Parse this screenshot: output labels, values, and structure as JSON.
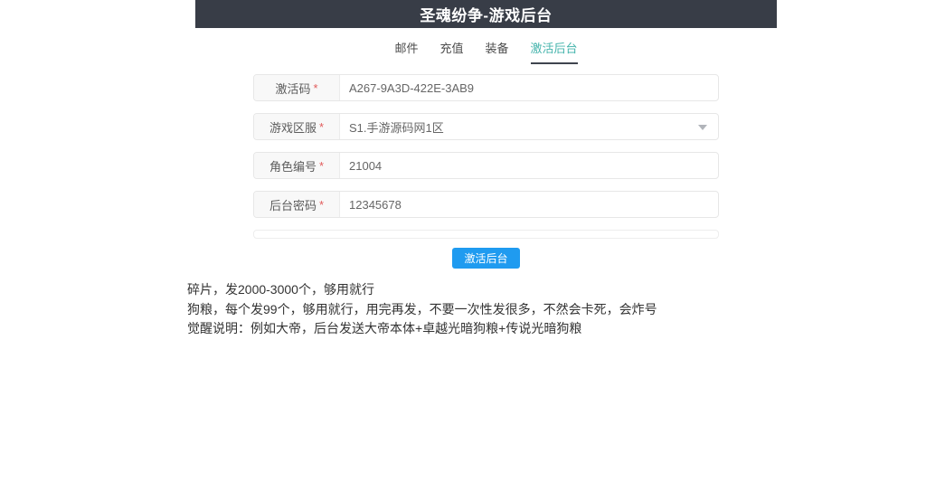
{
  "header": {
    "title": "圣魂纷争-游戏后台"
  },
  "tabs": [
    {
      "label": "邮件",
      "active": false
    },
    {
      "label": "充值",
      "active": false
    },
    {
      "label": "装备",
      "active": false
    },
    {
      "label": "激活后台",
      "active": true
    }
  ],
  "form": {
    "fields": [
      {
        "label": "激活码",
        "required": "*",
        "value": "A267-9A3D-422E-3AB9",
        "control": "text"
      },
      {
        "label": "游戏区服",
        "required": "*",
        "value": "S1.手游源码网1区",
        "control": "select"
      },
      {
        "label": "角色编号",
        "required": "*",
        "value": "21004",
        "control": "text"
      },
      {
        "label": "后台密码",
        "required": "*",
        "value": "12345678",
        "control": "text"
      }
    ],
    "submit_label": "激活后台"
  },
  "icons": {
    "server_select_caret": "chevron-down-icon"
  },
  "notes": {
    "lines": [
      "碎片，发2000-3000个，够用就行",
      "狗粮，每个发99个，够用就行，用完再发，不要一次性发很多，不然会卡死，会炸号",
      "觉醒说明：例如大帝，后台发送大帝本体+卓越光暗狗粮+传说光暗狗粮"
    ]
  },
  "colors": {
    "header-bg": "#383d47",
    "accent-teal": "#45b4ac",
    "accent-blue": "#1f9bf0",
    "required-red": "#e15b5b",
    "underline-dark": "#3f444e"
  }
}
